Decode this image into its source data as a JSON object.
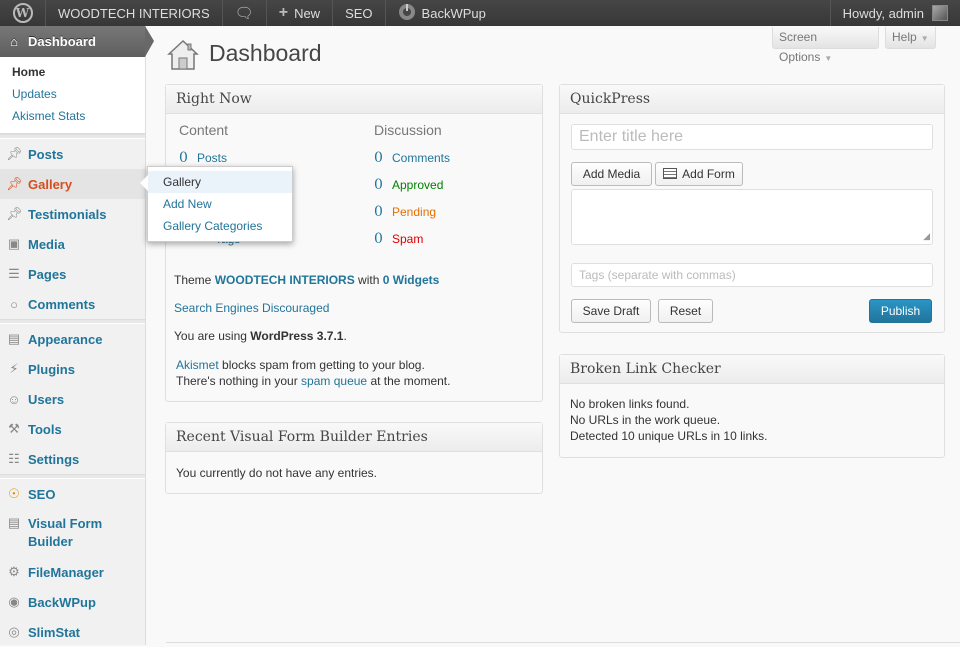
{
  "adminbar": {
    "site_name": "WOODTECH INTERIORS",
    "new_label": "New",
    "seo_label": "SEO",
    "backwpup_label": "BackWPup",
    "howdy": "Howdy, admin"
  },
  "sidebar": {
    "dashboard": "Dashboard",
    "dashboard_sub": [
      "Home",
      "Updates",
      "Akismet Stats"
    ],
    "items": [
      {
        "label": "Posts",
        "icon": "pushpin-icon"
      },
      {
        "label": "Gallery",
        "icon": "pushpin-icon"
      },
      {
        "label": "Testimonials",
        "icon": "pushpin-icon"
      },
      {
        "label": "Media",
        "icon": "media-icon"
      },
      {
        "label": "Pages",
        "icon": "pages-icon"
      },
      {
        "label": "Comments",
        "icon": "comments-icon"
      },
      {
        "label": "Appearance",
        "icon": "appearance-icon"
      },
      {
        "label": "Plugins",
        "icon": "plugins-icon"
      },
      {
        "label": "Users",
        "icon": "users-icon"
      },
      {
        "label": "Tools",
        "icon": "tools-icon"
      },
      {
        "label": "Settings",
        "icon": "settings-icon"
      },
      {
        "label": "SEO",
        "icon": "seo-icon"
      },
      {
        "label": "Visual Form Builder",
        "icon": "form-icon"
      },
      {
        "label": "FileManager",
        "icon": "gear-icon"
      },
      {
        "label": "BackWPup",
        "icon": "backwpup-icon"
      },
      {
        "label": "SlimStat",
        "icon": "slimstat-icon"
      }
    ]
  },
  "flyout": [
    "Gallery",
    "Add New",
    "Gallery Categories"
  ],
  "header": {
    "title": "Dashboard",
    "screen_options": "Screen Options",
    "help": "Help"
  },
  "right_now": {
    "title": "Right Now",
    "content_head": "Content",
    "discussion_head": "Discussion",
    "content_rows": [
      {
        "count": "0",
        "label": "Posts"
      },
      {
        "count": "",
        "label": ""
      },
      {
        "count": "",
        "label": ""
      },
      {
        "count": "",
        "label": "Tags"
      }
    ],
    "discussion_rows": [
      {
        "count": "0",
        "label": "Comments"
      },
      {
        "count": "0",
        "label": "Approved"
      },
      {
        "count": "0",
        "label": "Pending"
      },
      {
        "count": "0",
        "label": "Spam"
      }
    ],
    "theme_prefix": "Theme",
    "theme_name": "WOODTECH INTERIORS",
    "theme_with": "with",
    "widgets": "0 Widgets",
    "search_engines": "Search Engines Discouraged",
    "using_prefix": "You are using",
    "wp_version": "WordPress 3.7.1",
    "akismet_link": "Akismet",
    "akismet_text": "blocks spam from getting to your blog.",
    "spam_prefix": "There's nothing in your",
    "spam_queue": "spam queue",
    "spam_suffix": "at the moment."
  },
  "vfb": {
    "title": "Recent Visual Form Builder Entries",
    "text": "You currently do not have any entries."
  },
  "quickpress": {
    "title": "QuickPress",
    "title_placeholder": "Enter title here",
    "add_media": "Add Media",
    "add_form": "Add Form",
    "tags_placeholder": "Tags (separate with commas)",
    "save_draft": "Save Draft",
    "reset": "Reset",
    "publish": "Publish"
  },
  "broken_links": {
    "title": "Broken Link Checker",
    "lines": [
      "No broken links found.",
      "No URLs in the work queue.",
      "Detected 10 unique URLs in 10 links."
    ]
  }
}
